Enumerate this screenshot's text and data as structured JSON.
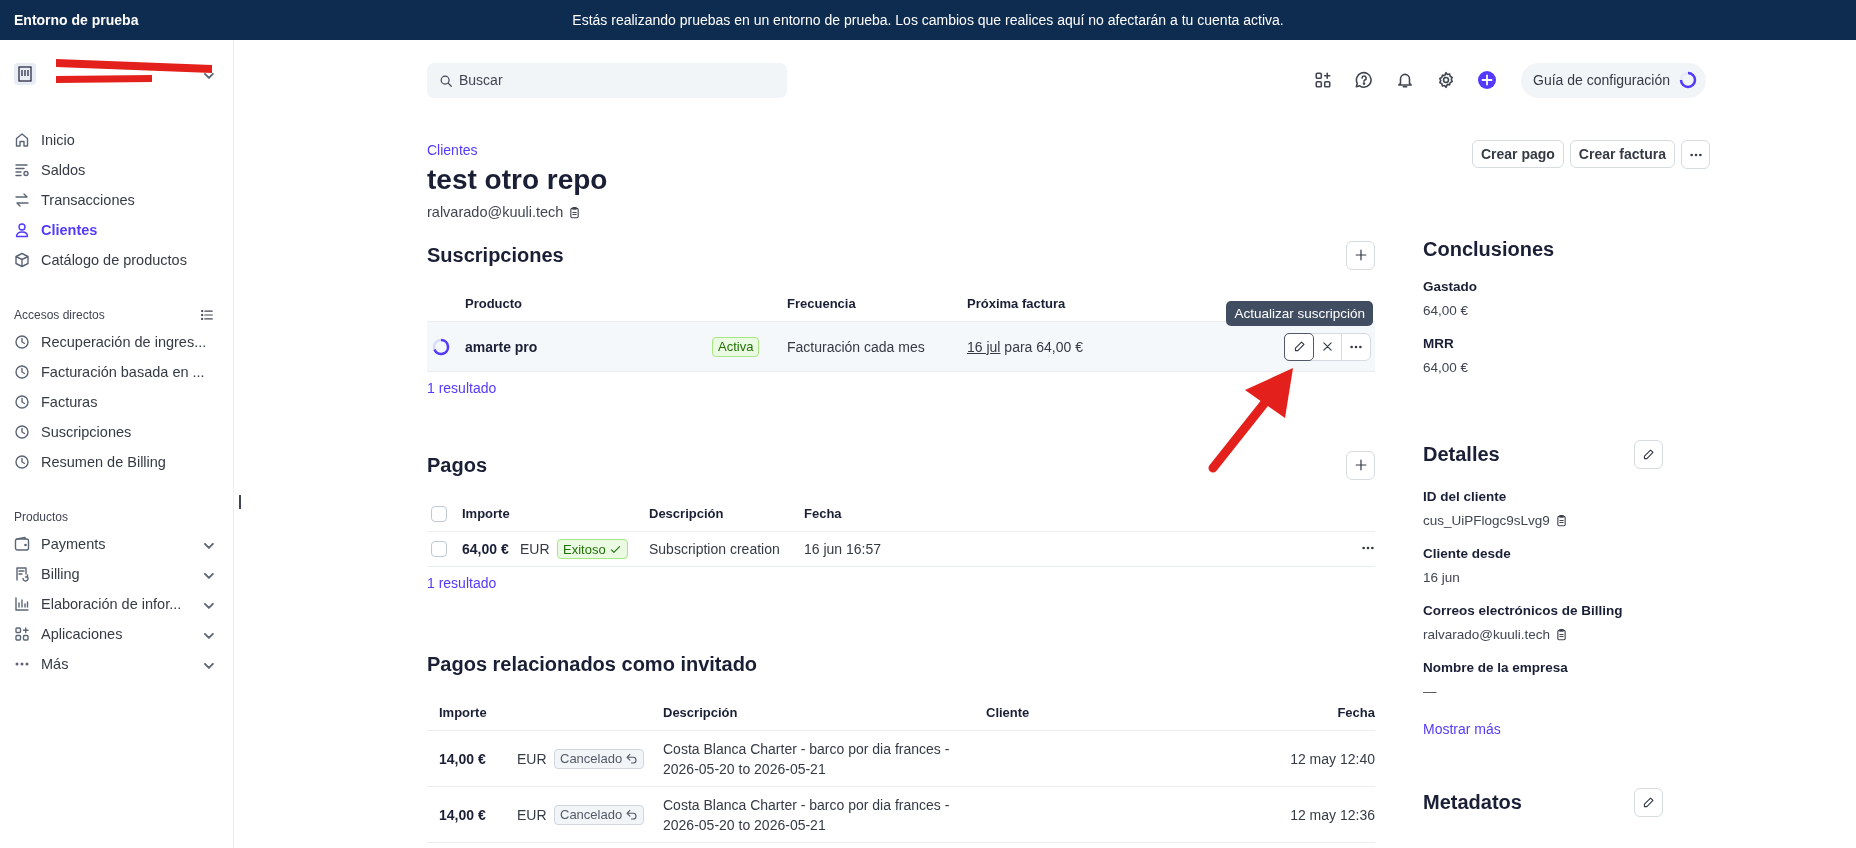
{
  "banner": {
    "title": "Entorno de prueba",
    "message": "Estás realizando pruebas en un entorno de prueba. Los cambios que realices aquí no afectarán a tu cuenta activa."
  },
  "sidebar": {
    "nav": [
      {
        "label": "Inicio",
        "selected": false
      },
      {
        "label": "Saldos",
        "selected": false
      },
      {
        "label": "Transacciones",
        "selected": false
      },
      {
        "label": "Clientes",
        "selected": true
      },
      {
        "label": "Catálogo de productos",
        "selected": false
      }
    ],
    "shortcuts": {
      "title": "Accesos directos",
      "items": [
        "Recuperación de ingres...",
        "Facturación basada en ...",
        "Facturas",
        "Suscripciones",
        "Resumen de Billing"
      ]
    },
    "products": {
      "title": "Productos",
      "items": [
        "Payments",
        "Billing",
        "Elaboración de infor...",
        "Aplicaciones",
        "Más"
      ]
    }
  },
  "topbar": {
    "search": {
      "placeholder": "Buscar"
    },
    "setup_guide": {
      "label": "Guía de configuración"
    }
  },
  "header": {
    "breadcrumb": "Clientes",
    "title": "test otro repo",
    "email": "ralvarado@kuuli.tech",
    "actions": [
      "Crear pago",
      "Crear factura"
    ]
  },
  "subscriptions": {
    "title": "Suscripciones",
    "columns": [
      "Producto",
      "Frecuencia",
      "Próxima factura"
    ],
    "rows": [
      {
        "product": "amarte pro",
        "status": "Activa",
        "frequency": "Facturación cada mes",
        "next_date": "16 jul",
        "next_rest": "para 64,00 €"
      }
    ],
    "tooltip": "Actualizar suscripción",
    "footer": "1 resultado"
  },
  "payments": {
    "title": "Pagos",
    "select_all": {
      "checked": false
    },
    "columns": [
      "Importe",
      "Descripción",
      "Fecha"
    ],
    "rows": [
      {
        "checked": false,
        "amount": "64,00 €",
        "currency": "EUR",
        "status": "Exitoso",
        "kind": "success",
        "description": "Subscription creation",
        "date": "16 jun 16:57"
      }
    ],
    "footer": "1 resultado"
  },
  "guest_payments": {
    "title": "Pagos relacionados como invitado",
    "columns": [
      "Importe",
      "Descripción",
      "Cliente",
      "Fecha"
    ],
    "rows": [
      {
        "amount": "14,00 €",
        "currency": "EUR",
        "status": "Cancelado",
        "kind": "canceled",
        "description": "Costa Blanca Charter - barco por dia frances - 2026-05-20 to 2026-05-21",
        "date": "12 may 12:40"
      },
      {
        "amount": "14,00 €",
        "currency": "EUR",
        "status": "Cancelado",
        "kind": "canceled",
        "description": "Costa Blanca Charter - barco por dia frances - 2026-05-20 to 2026-05-21",
        "date": "12 may 12:36"
      }
    ]
  },
  "conclusions": {
    "title": "Conclusiones",
    "items": [
      {
        "label": "Gastado",
        "value": "64,00 €"
      },
      {
        "label": "MRR",
        "value": "64,00 €"
      }
    ]
  },
  "details": {
    "title": "Detalles",
    "items": [
      {
        "label": "ID del cliente",
        "value": "cus_UiPFlogc9sLvg9",
        "copy": true
      },
      {
        "label": "Cliente desde",
        "value": "16 jun",
        "copy": false
      },
      {
        "label": "Correos electrónicos de Billing",
        "value": "ralvarado@kuuli.tech",
        "copy": true
      },
      {
        "label": "Nombre de la empresa",
        "value": "—",
        "copy": false
      }
    ],
    "show_more": "Mostrar más"
  },
  "metadata": {
    "title": "Metadatos"
  }
}
